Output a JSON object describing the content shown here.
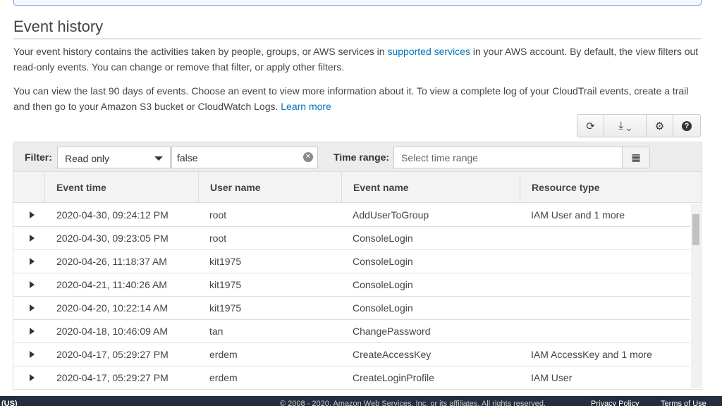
{
  "title": "Event history",
  "intro": {
    "p1_before": "Your event history contains the activities taken by people, groups, or AWS services in ",
    "p1_link": "supported services",
    "p1_after": " in your AWS account. By default, the view filters out read-only events. You can change or remove that filter, or apply other filters.",
    "p2": "You can view the last 90 days of events. Choose an event to view more information about it. To view a complete log of your CloudTrail events, create a trail and then go to your Amazon S3 bucket or CloudWatch Logs. ",
    "p2_link": "Learn more"
  },
  "toolbar": {
    "refresh": "refresh-icon",
    "download": "download-icon",
    "settings": "gear-icon",
    "help": "help-icon"
  },
  "filter": {
    "label": "Filter:",
    "attribute": "Read only",
    "value": "false",
    "time_label": "Time range:",
    "time_placeholder": "Select time range"
  },
  "columns": [
    "Event time",
    "User name",
    "Event name",
    "Resource type"
  ],
  "rows": [
    [
      "2020-04-30, 09:24:12 PM",
      "root",
      "AddUserToGroup",
      "IAM User and 1 more"
    ],
    [
      "2020-04-30, 09:23:05 PM",
      "root",
      "ConsoleLogin",
      ""
    ],
    [
      "2020-04-26, 11:18:37 AM",
      "kit1975",
      "ConsoleLogin",
      ""
    ],
    [
      "2020-04-21, 11:40:26 AM",
      "kit1975",
      "ConsoleLogin",
      ""
    ],
    [
      "2020-04-20, 10:22:14 AM",
      "kit1975",
      "ConsoleLogin",
      ""
    ],
    [
      "2020-04-18, 10:46:09 AM",
      "tan",
      "ChangePassword",
      ""
    ],
    [
      "2020-04-17, 05:29:27 PM",
      "erdem",
      "CreateAccessKey",
      "IAM AccessKey and 1 more"
    ],
    [
      "2020-04-17, 05:29:27 PM",
      "erdem",
      "CreateLoginProfile",
      "IAM User"
    ]
  ],
  "footer": {
    "language": "(US)",
    "copyright": "© 2008 - 2020, Amazon Web Services, Inc. or its affiliates. All rights reserved.",
    "privacy": "Privacy Policy",
    "terms": "Terms of Use"
  }
}
